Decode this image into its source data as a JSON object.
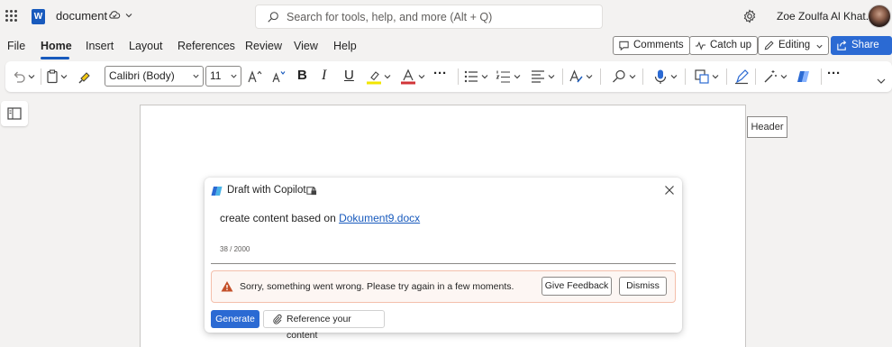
{
  "titlebar": {
    "doc_name": "document",
    "search_placeholder": "Search for tools, help, and more (Alt + Q)",
    "user_name": "Zoe Zoulfa Al Khat...",
    "app_logo_letter": "W"
  },
  "menu": {
    "tabs": [
      "File",
      "Home",
      "Insert",
      "Layout",
      "References",
      "Review",
      "View",
      "Help"
    ],
    "active_tab": "Home",
    "comments_label": "Comments",
    "catchup_label": "Catch up",
    "editing_label": "Editing",
    "share_label": "Share"
  },
  "ribbon": {
    "font_name": "Calibri (Body)",
    "font_size": "11",
    "bold": "B",
    "italic": "I",
    "underline": "U",
    "more": "···",
    "highlight_color": "#f2e600",
    "font_color": "#d13438"
  },
  "page": {
    "header_tag": "Header"
  },
  "copilot": {
    "title": "Draft with Copilot",
    "prompt_prefix": "create content based on ",
    "prompt_link": "Dokument9.docx",
    "char_count": "38 / 2000",
    "error_message": "Sorry, something went wrong. Please try again in a few moments.",
    "feedback_label": "Give Feedback",
    "dismiss_label": "Dismiss",
    "generate_label": "Generate",
    "reference_label": "Reference your content"
  },
  "colors": {
    "accent": "#185abd",
    "primary_button": "#2b6ad3",
    "warning_bg": "#fdf6f3",
    "warning_icon": "#c4502a"
  }
}
